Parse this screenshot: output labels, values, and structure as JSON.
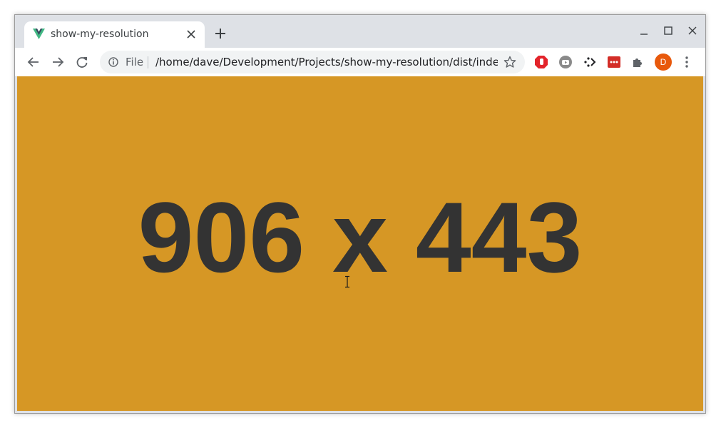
{
  "browser": {
    "tab": {
      "title": "show-my-resolution",
      "favicon": "vue-logo-icon"
    },
    "toolbar": {
      "scheme_label": "File",
      "url": "/home/dave/Development/Projects/show-my-resolution/dist/inde...",
      "profile_initial": "D",
      "extensions": [
        "ublock-icon",
        "youtube-icon",
        "dots-arrow-icon",
        "lastpass-icon",
        "puzzle-extensions-icon"
      ]
    }
  },
  "page": {
    "resolution_text": "906 x 443",
    "background_color": "#d69725",
    "text_color": "#333333"
  }
}
